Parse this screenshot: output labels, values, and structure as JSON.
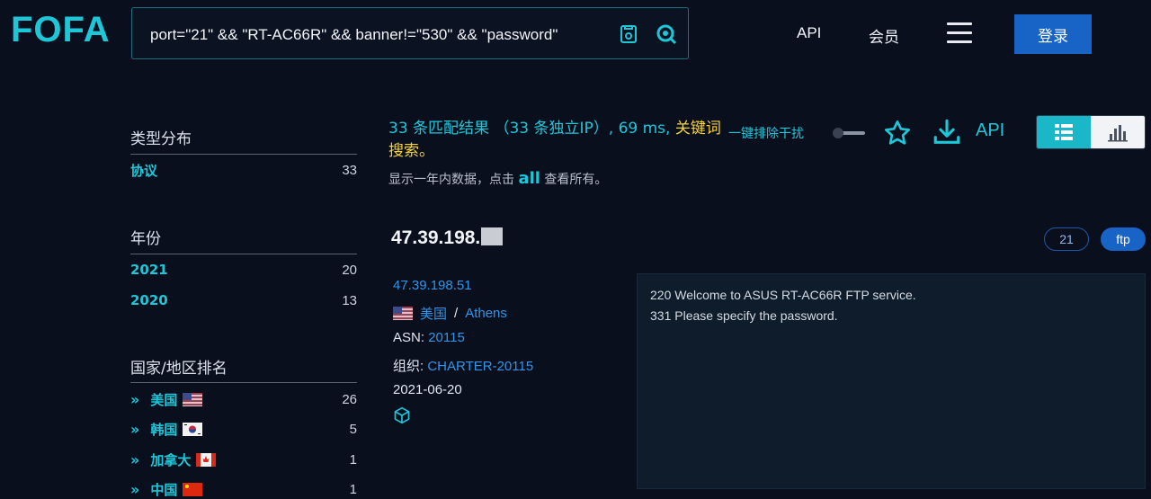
{
  "header": {
    "logo": "FOFA",
    "search_query": "port=\"21\" && \"RT-AC66R\" && banner!=\"530\" && \"password\"",
    "nav_api": "API",
    "nav_member": "会员",
    "login": "登录"
  },
  "sidebar": {
    "type_title": "类型分布",
    "type_items": [
      {
        "label": "协议",
        "count": "33"
      }
    ],
    "year_title": "年份",
    "year_items": [
      {
        "label": "2021",
        "count": "20"
      },
      {
        "label": "2020",
        "count": "13"
      }
    ],
    "country_title": "国家/地区排名",
    "country_items": [
      {
        "label": "美国",
        "count": "26",
        "flag": "us"
      },
      {
        "label": "韩国",
        "count": "5",
        "flag": "kr"
      },
      {
        "label": "加拿大",
        "count": "1",
        "flag": "ca"
      },
      {
        "label": "中国",
        "count": "1",
        "flag": "cn"
      }
    ]
  },
  "summary": {
    "results": "33",
    "results_label": "条匹配结果",
    "open_paren": "（",
    "unique_ip": "33",
    "unique_ip_label": "条独立IP",
    "close_paren": "）,",
    "time": "69 ms",
    "comma": ",",
    "keyword_search": "关键词搜索。",
    "hint_pre": "显示一年内数据，点击",
    "hint_all": "all",
    "hint_post": "查看所有。",
    "dedupe": "一键排除干扰",
    "api": "API"
  },
  "result": {
    "ip_head": "47.39.198.",
    "port_tag": "21",
    "protocol_tag": "ftp",
    "ip": "47.39.198.51",
    "country": "美国",
    "separator": "/",
    "city": "Athens",
    "asn_label": "ASN:",
    "asn": "20115",
    "org_label": "组织:",
    "org": "CHARTER-20115",
    "date": "2021-06-20",
    "banner_lines": [
      "220 Welcome to ASUS RT-AC66R FTP service.",
      "331 Please specify the password."
    ]
  },
  "colors": {
    "accent": "#1ec7d8",
    "brand_blue": "#1763c6",
    "highlight": "#f5d33b",
    "background": "#0a0f1e"
  }
}
